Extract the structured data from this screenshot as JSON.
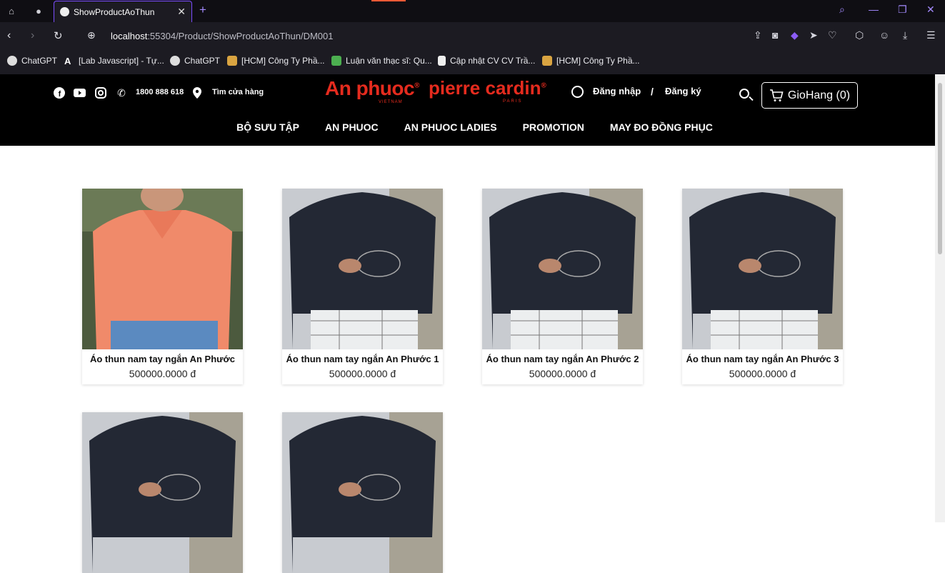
{
  "browser": {
    "tab_title": "ShowProductAoThun",
    "url_host": "localhost",
    "url_path": ":55304/Product/ShowProductAoThun/DM001",
    "bookmarks": [
      {
        "label": "ChatGPT",
        "color": "#ffffff"
      },
      {
        "label": "[Lab Javascript] - Tự...",
        "color": "#ffffff"
      },
      {
        "label": "ChatGPT",
        "color": "#ffffff"
      },
      {
        "label": "[HCM] Công Ty Phầ...",
        "color": "#d9a441"
      },
      {
        "label": "Luận văn thạc sĩ: Qu...",
        "color": "#4caf50"
      },
      {
        "label": "Cập nhật CV CV Trầ...",
        "color": "#ffffff"
      },
      {
        "label": "[HCM] Công Ty Phầ...",
        "color": "#d9a441"
      }
    ]
  },
  "header": {
    "hotline": "1800 888 618",
    "store_finder": "Tìm cửa hàng",
    "logo_anphuoc": "An phuoc",
    "logo_anphuoc_sub": "VIETNAM",
    "logo_pierre": "pierre cardin",
    "logo_pierre_sub": "PARIS",
    "login": "Đăng nhập",
    "slash": "/",
    "signup": "Đăng ký",
    "cart": "GioHang (0)",
    "brand_color": "#e52b1e"
  },
  "menu": [
    "BỘ SƯU TẬP",
    "AN PHUOC",
    "AN PHUOC LADIES",
    "PROMOTION",
    "MAY ĐO ĐỒNG PHỤC"
  ],
  "products": [
    {
      "name": "Áo thun nam tay ngắn An Phước",
      "price": "500000.0000 đ",
      "shirt": "coral"
    },
    {
      "name": "Áo thun nam tay ngắn An Phước 1",
      "price": "500000.0000 đ",
      "shirt": "navy"
    },
    {
      "name": "Áo thun nam tay ngắn An Phước 2",
      "price": "500000.0000 đ",
      "shirt": "navy"
    },
    {
      "name": "Áo thun nam tay ngắn An Phước 3",
      "price": "500000.0000 đ",
      "shirt": "navy"
    },
    {
      "name": "",
      "price": "",
      "shirt": "navy"
    },
    {
      "name": "",
      "price": "",
      "shirt": "navy"
    }
  ]
}
